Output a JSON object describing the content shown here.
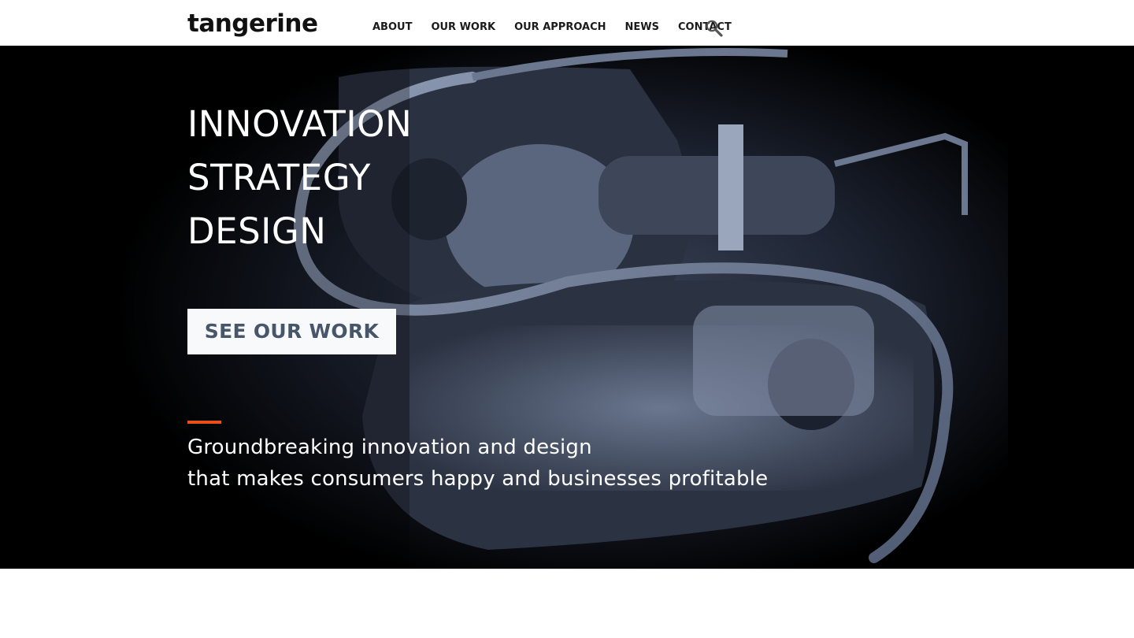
{
  "header": {
    "logo": "tangerine",
    "nav": [
      {
        "label": "ABOUT"
      },
      {
        "label": "OUR WORK"
      },
      {
        "label": "OUR APPROACH"
      },
      {
        "label": "NEWS"
      },
      {
        "label": "CONTACT"
      }
    ],
    "search_icon": "search-icon"
  },
  "hero": {
    "headline": [
      "INNOVATION",
      "STRATEGY",
      "DESIGN"
    ],
    "cta_label": "SEE OUR WORK",
    "tagline": [
      "Groundbreaking innovation and design",
      "that makes consumers happy and businesses profitable"
    ],
    "image": "overhead view of two passengers in curved airline seat pods",
    "accent_color": "#e8501b",
    "cta_text_color": "#48566a"
  }
}
